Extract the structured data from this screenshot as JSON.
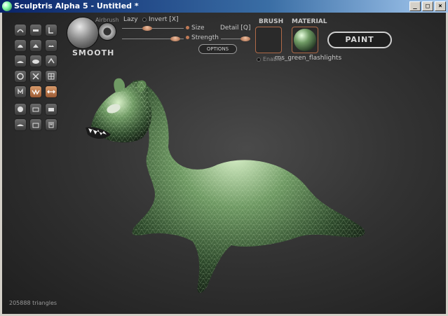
{
  "window": {
    "title": "Sculptris Alpha 5 - Untitled *",
    "buttons": [
      "_",
      "□",
      "×"
    ]
  },
  "toolbar": {
    "brush_name": "SMOOTH",
    "airbrush_label": "Airbrush",
    "lazy_label": "Lazy",
    "invert_label": "Invert [X]",
    "size_label": "Size",
    "detail_label": "Detail [Q]",
    "strength_label": "Strength",
    "options_label": "OPTIONS",
    "brush_heading": "BRUSH",
    "material_heading": "MATERIAL",
    "material_name": "rns_green_flashlights",
    "enable_label": "Enable",
    "paint_label": "PAINT"
  },
  "status": {
    "triangles": "205888 triangles"
  },
  "colors": {
    "accent": "#c07a56",
    "model_green": "#5f8a56"
  }
}
